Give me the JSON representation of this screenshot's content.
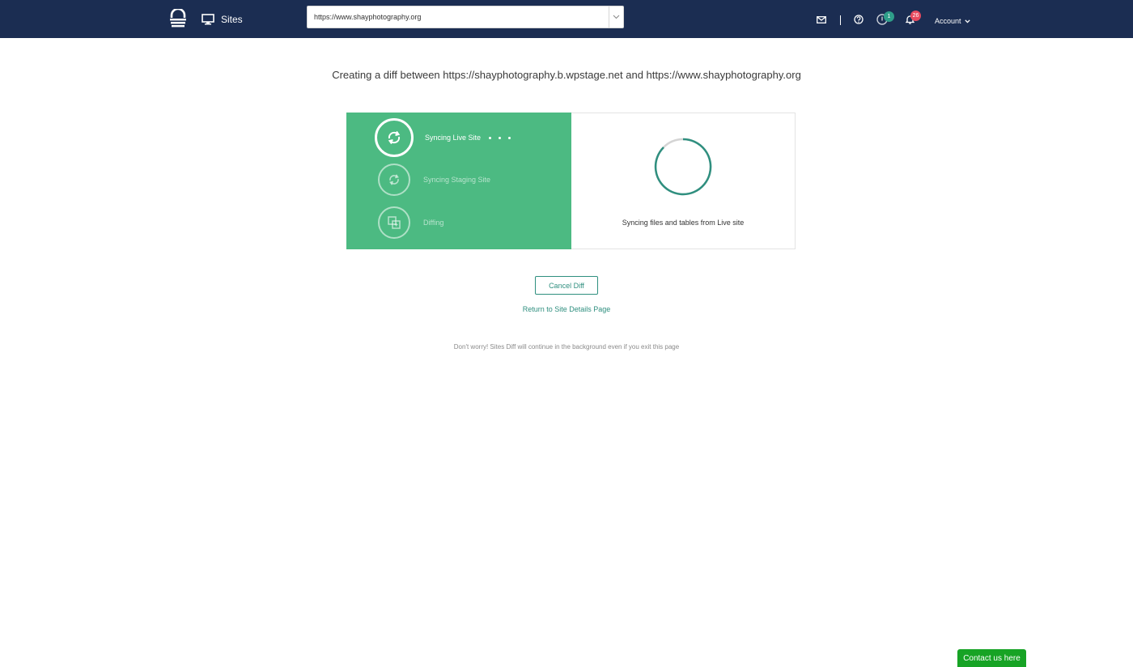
{
  "navbar": {
    "sites_label": "Sites",
    "site_select_value": "https://www.shayphotography.org",
    "badges": {
      "status_count": "1",
      "notifications_count": "26"
    },
    "account_label": "Account"
  },
  "main": {
    "title": "Creating a diff between https://shayphotography.b.wpstage.net and https://www.shayphotography.org",
    "steps": [
      {
        "label": "Syncing Live Site",
        "state": "active"
      },
      {
        "label": "Syncing Staging Site",
        "state": "pending"
      },
      {
        "label": "Diffing",
        "state": "pending"
      }
    ],
    "status_text": "Syncing files and tables from Live site",
    "cancel_label": "Cancel Diff",
    "return_label": "Return to Site Details Page",
    "background_note": "Don't worry! Sites Diff will continue in the background even if you exit this page"
  },
  "contact_label": "Contact us here",
  "colors": {
    "navbar": "#1b2d52",
    "steps_panel": "#4cba82",
    "accent": "#2f8f7f",
    "contact": "#17a325",
    "badge_red": "#e84a5f"
  }
}
